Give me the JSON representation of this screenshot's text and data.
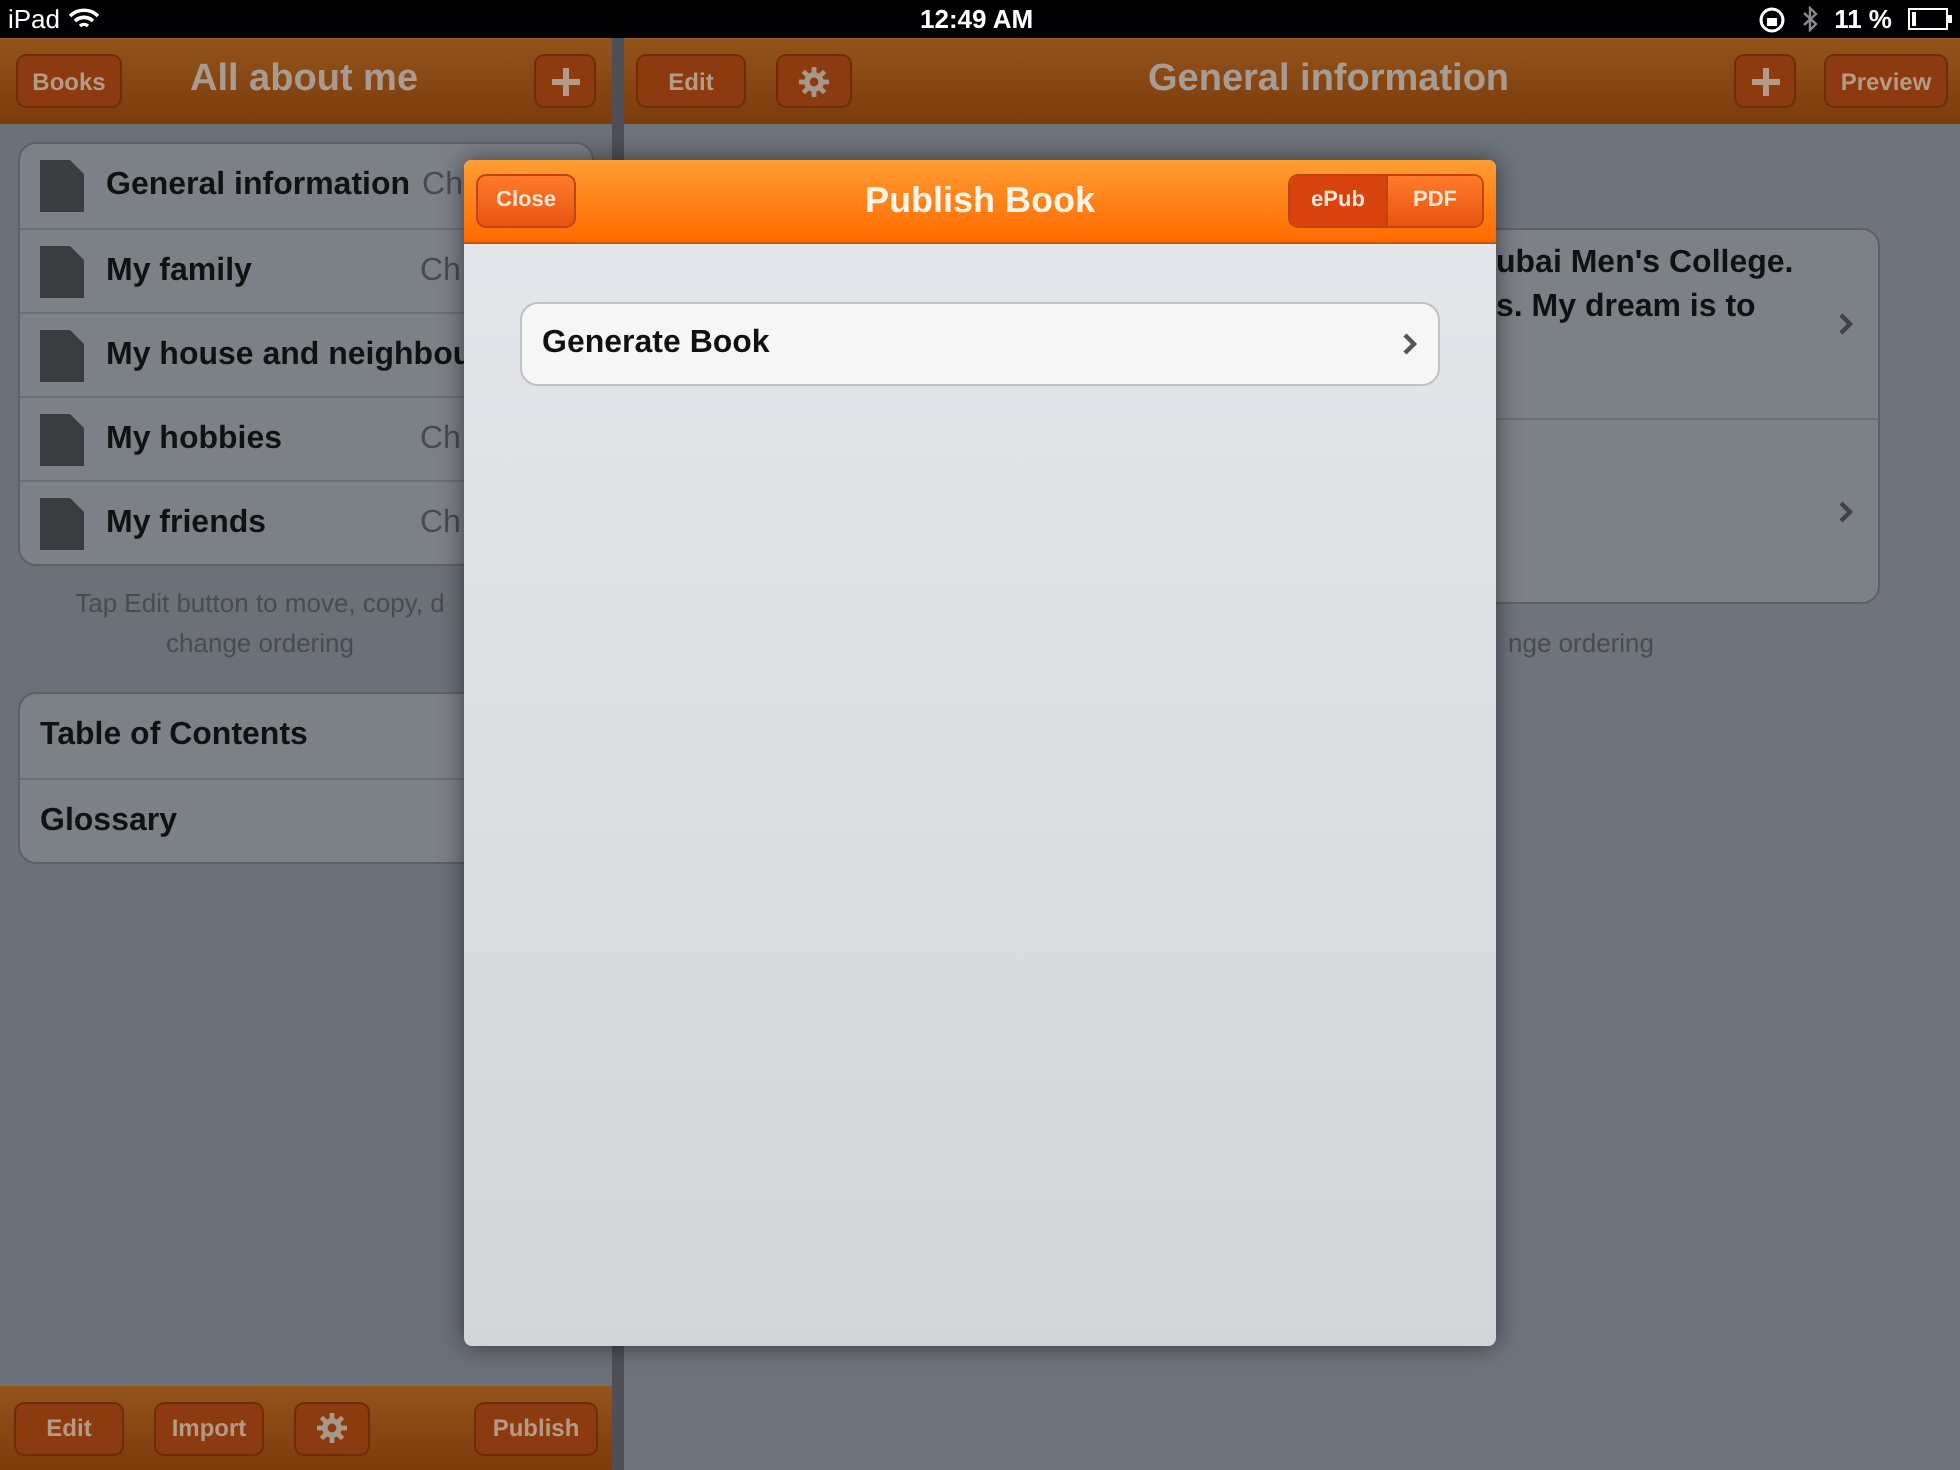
{
  "status_bar": {
    "carrier": "iPad",
    "time": "12:49 AM",
    "battery": "11 %"
  },
  "left": {
    "nav": {
      "back": "Books",
      "title": "All about me"
    },
    "chapters": [
      {
        "name": "General information",
        "tail": "Ch"
      },
      {
        "name": "My family",
        "tail": "Ch"
      },
      {
        "name": "My house and neighbou"
      },
      {
        "name": "My hobbies",
        "tail": "Ch"
      },
      {
        "name": "My friends",
        "tail": "Ch"
      }
    ],
    "hint": [
      "Tap Edit button to move, copy, d",
      "change ordering"
    ],
    "extras": [
      "Table of Contents",
      "Glossary"
    ],
    "toolbar": {
      "edit": "Edit",
      "import": "Import",
      "publish": "Publish"
    }
  },
  "right": {
    "nav": {
      "edit": "Edit",
      "title": "General information",
      "preview": "Preview"
    },
    "entries": [
      {
        "lines": [
          "ubai Men's College.",
          "s. My dream is to"
        ]
      }
    ],
    "hint": "nge ordering"
  },
  "dialog": {
    "title": "Publish Book",
    "close": "Close",
    "formats": [
      {
        "label": "ePub",
        "selected": true
      },
      {
        "label": "PDF",
        "selected": false
      }
    ],
    "items": [
      {
        "label": "Generate Book"
      }
    ]
  }
}
